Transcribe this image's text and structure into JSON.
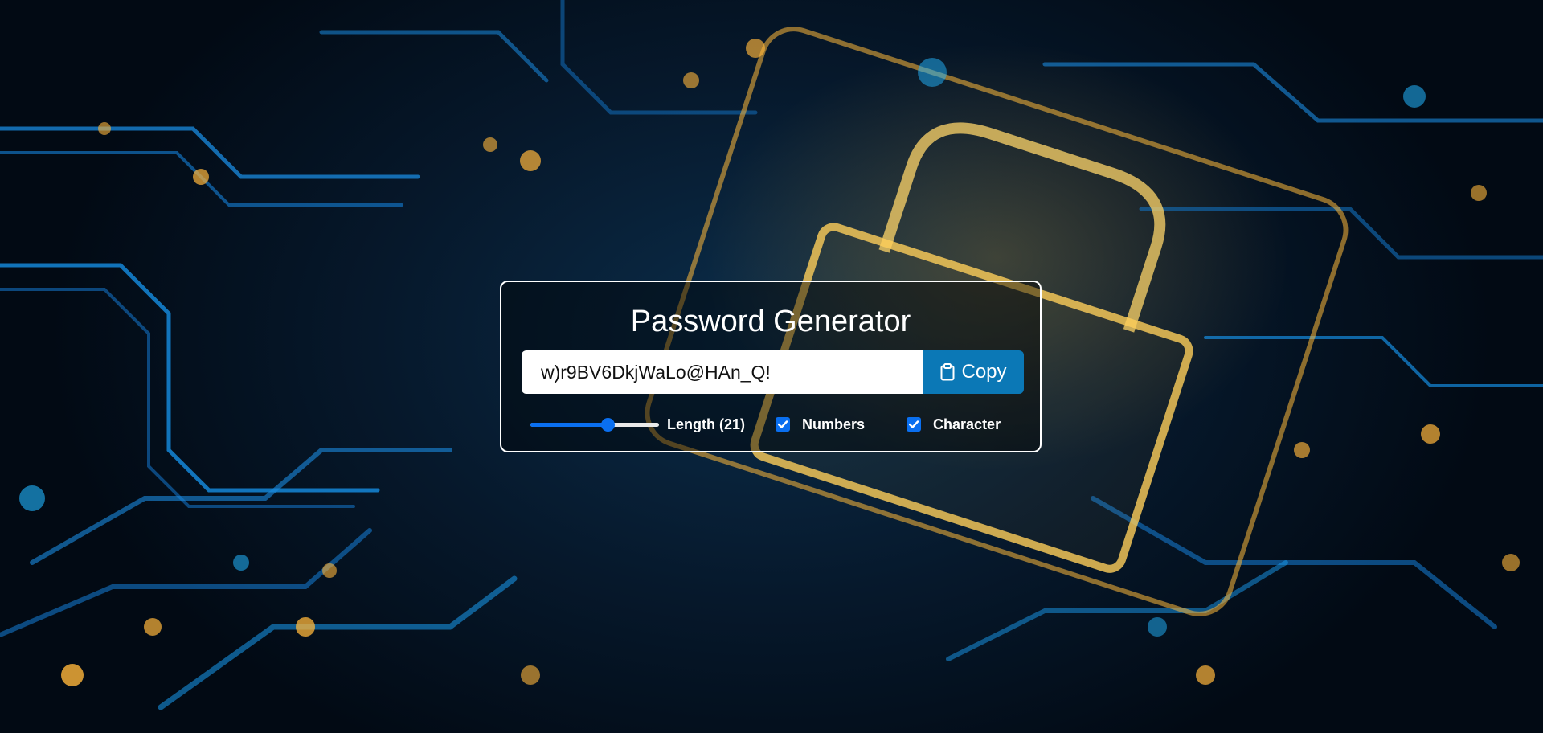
{
  "app": {
    "title": "Password Generator"
  },
  "password": {
    "value": "w)r9BV6DkjWaLo@HAn_Q!"
  },
  "copy_button": {
    "label": "Copy",
    "icon": "clipboard-icon"
  },
  "options": {
    "length_label": "Length (21)",
    "length_slider_fraction": 0.6,
    "numbers": {
      "label": "Numbers",
      "checked": true
    },
    "characters": {
      "label": "Character",
      "checked": true
    }
  },
  "colors": {
    "accent": "#0a6ff0",
    "copy_button": "#0b78b6",
    "card_border": "#ffffff"
  }
}
